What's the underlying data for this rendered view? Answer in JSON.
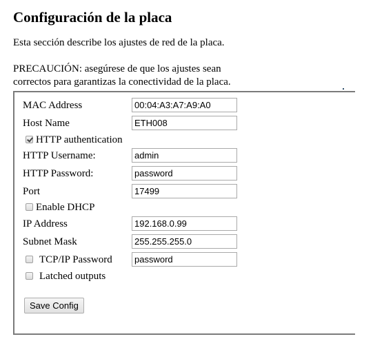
{
  "page": {
    "title": "Configuración de la placa",
    "description": "Esta sección describe los ajustes de red de la placa.",
    "warning_line1": "PRECAUCIÓN: asegúrese de que los ajustes sean",
    "warning_line2": "correctos para garantizas la conectividad de la placa."
  },
  "form": {
    "mac_address": {
      "label": "MAC Address",
      "value": "00:04:A3:A7:A9:A0"
    },
    "host_name": {
      "label": "Host Name",
      "value": "ETH008"
    },
    "http_auth": {
      "label": "HTTP authentication",
      "checked": true
    },
    "http_username": {
      "label": "HTTP Username:",
      "value": "admin"
    },
    "http_password": {
      "label": "HTTP Password:",
      "value": "password"
    },
    "port": {
      "label": "Port",
      "value": "17499"
    },
    "enable_dhcp": {
      "label": "Enable DHCP",
      "checked": false
    },
    "ip_address": {
      "label": "IP Address",
      "value": "192.168.0.99"
    },
    "subnet_mask": {
      "label": "Subnet Mask",
      "value": "255.255.255.0"
    },
    "tcpip_password": {
      "label": "TCP/IP Password",
      "checked": false,
      "value": "password"
    },
    "latched_outputs": {
      "label": "Latched outputs",
      "checked": false
    },
    "save_label": "Save Config"
  }
}
